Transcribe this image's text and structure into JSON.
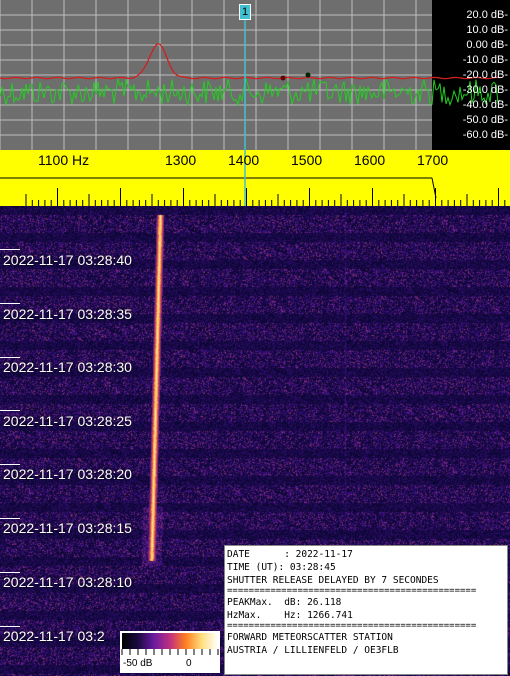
{
  "spectrum": {
    "db_labels": [
      "20.0 dB-",
      "10.0 dB-",
      "0.00 dB-",
      "-10.0 dB-",
      "-20.0 dB-",
      "-30.0 dB-",
      "-40.0 dB-",
      "-50.0 dB-",
      "-60.0 dB-"
    ],
    "marker_label": "1",
    "colors": {
      "bg": "#6e6e6e",
      "grid": "#bfbfbf",
      "red": "#d02020",
      "green": "#20d020",
      "marker": "#40c0d0"
    }
  },
  "ruler": {
    "freq_labels": [
      "1100 Hz",
      "1300",
      "1400",
      "1500",
      "1600",
      "1700"
    ],
    "color": "#ffff00"
  },
  "waterfall": {
    "timestamps": [
      "2022-11-17 03:28:40",
      "2022-11-17 03:28:35",
      "2022-11-17 03:28:30",
      "2022-11-17 03:28:25",
      "2022-11-17 03:28:20",
      "2022-11-17 03:28:15",
      "2022-11-17 03:28:10",
      "2022-11-17 03:2"
    ]
  },
  "legend": {
    "min_label": "-50 dB",
    "max_label": "0"
  },
  "info": {
    "date_line": "DATE      : 2022-11-17",
    "time_line": "TIME (UT): 03:28:45",
    "shutter_line": "SHUTTER RELEASE DELAYED BY 7 SECONDES",
    "separator": "==============================================",
    "peak_line": "PEAKMax.  dB: 26.118",
    "hz_line": "HzMax.    Hz: 1266.741",
    "station_line": "FORWARD METEORSCATTER STATION",
    "location_line": "AUSTRIA / LILLIENFELD / OE3FLB"
  }
}
